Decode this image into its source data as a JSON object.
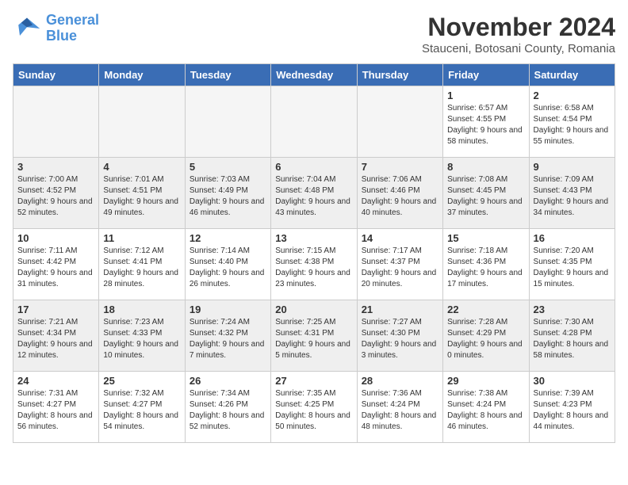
{
  "header": {
    "logo_line1": "General",
    "logo_line2": "Blue",
    "title": "November 2024",
    "subtitle": "Stauceni, Botosani County, Romania"
  },
  "columns": [
    "Sunday",
    "Monday",
    "Tuesday",
    "Wednesday",
    "Thursday",
    "Friday",
    "Saturday"
  ],
  "weeks": [
    {
      "shaded": false,
      "days": [
        {
          "num": "",
          "info": "",
          "empty": true
        },
        {
          "num": "",
          "info": "",
          "empty": true
        },
        {
          "num": "",
          "info": "",
          "empty": true
        },
        {
          "num": "",
          "info": "",
          "empty": true
        },
        {
          "num": "",
          "info": "",
          "empty": true
        },
        {
          "num": "1",
          "info": "Sunrise: 6:57 AM\nSunset: 4:55 PM\nDaylight: 9 hours and 58 minutes."
        },
        {
          "num": "2",
          "info": "Sunrise: 6:58 AM\nSunset: 4:54 PM\nDaylight: 9 hours and 55 minutes."
        }
      ]
    },
    {
      "shaded": true,
      "days": [
        {
          "num": "3",
          "info": "Sunrise: 7:00 AM\nSunset: 4:52 PM\nDaylight: 9 hours and 52 minutes."
        },
        {
          "num": "4",
          "info": "Sunrise: 7:01 AM\nSunset: 4:51 PM\nDaylight: 9 hours and 49 minutes."
        },
        {
          "num": "5",
          "info": "Sunrise: 7:03 AM\nSunset: 4:49 PM\nDaylight: 9 hours and 46 minutes."
        },
        {
          "num": "6",
          "info": "Sunrise: 7:04 AM\nSunset: 4:48 PM\nDaylight: 9 hours and 43 minutes."
        },
        {
          "num": "7",
          "info": "Sunrise: 7:06 AM\nSunset: 4:46 PM\nDaylight: 9 hours and 40 minutes."
        },
        {
          "num": "8",
          "info": "Sunrise: 7:08 AM\nSunset: 4:45 PM\nDaylight: 9 hours and 37 minutes."
        },
        {
          "num": "9",
          "info": "Sunrise: 7:09 AM\nSunset: 4:43 PM\nDaylight: 9 hours and 34 minutes."
        }
      ]
    },
    {
      "shaded": false,
      "days": [
        {
          "num": "10",
          "info": "Sunrise: 7:11 AM\nSunset: 4:42 PM\nDaylight: 9 hours and 31 minutes."
        },
        {
          "num": "11",
          "info": "Sunrise: 7:12 AM\nSunset: 4:41 PM\nDaylight: 9 hours and 28 minutes."
        },
        {
          "num": "12",
          "info": "Sunrise: 7:14 AM\nSunset: 4:40 PM\nDaylight: 9 hours and 26 minutes."
        },
        {
          "num": "13",
          "info": "Sunrise: 7:15 AM\nSunset: 4:38 PM\nDaylight: 9 hours and 23 minutes."
        },
        {
          "num": "14",
          "info": "Sunrise: 7:17 AM\nSunset: 4:37 PM\nDaylight: 9 hours and 20 minutes."
        },
        {
          "num": "15",
          "info": "Sunrise: 7:18 AM\nSunset: 4:36 PM\nDaylight: 9 hours and 17 minutes."
        },
        {
          "num": "16",
          "info": "Sunrise: 7:20 AM\nSunset: 4:35 PM\nDaylight: 9 hours and 15 minutes."
        }
      ]
    },
    {
      "shaded": true,
      "days": [
        {
          "num": "17",
          "info": "Sunrise: 7:21 AM\nSunset: 4:34 PM\nDaylight: 9 hours and 12 minutes."
        },
        {
          "num": "18",
          "info": "Sunrise: 7:23 AM\nSunset: 4:33 PM\nDaylight: 9 hours and 10 minutes."
        },
        {
          "num": "19",
          "info": "Sunrise: 7:24 AM\nSunset: 4:32 PM\nDaylight: 9 hours and 7 minutes."
        },
        {
          "num": "20",
          "info": "Sunrise: 7:25 AM\nSunset: 4:31 PM\nDaylight: 9 hours and 5 minutes."
        },
        {
          "num": "21",
          "info": "Sunrise: 7:27 AM\nSunset: 4:30 PM\nDaylight: 9 hours and 3 minutes."
        },
        {
          "num": "22",
          "info": "Sunrise: 7:28 AM\nSunset: 4:29 PM\nDaylight: 9 hours and 0 minutes."
        },
        {
          "num": "23",
          "info": "Sunrise: 7:30 AM\nSunset: 4:28 PM\nDaylight: 8 hours and 58 minutes."
        }
      ]
    },
    {
      "shaded": false,
      "days": [
        {
          "num": "24",
          "info": "Sunrise: 7:31 AM\nSunset: 4:27 PM\nDaylight: 8 hours and 56 minutes."
        },
        {
          "num": "25",
          "info": "Sunrise: 7:32 AM\nSunset: 4:27 PM\nDaylight: 8 hours and 54 minutes."
        },
        {
          "num": "26",
          "info": "Sunrise: 7:34 AM\nSunset: 4:26 PM\nDaylight: 8 hours and 52 minutes."
        },
        {
          "num": "27",
          "info": "Sunrise: 7:35 AM\nSunset: 4:25 PM\nDaylight: 8 hours and 50 minutes."
        },
        {
          "num": "28",
          "info": "Sunrise: 7:36 AM\nSunset: 4:24 PM\nDaylight: 8 hours and 48 minutes."
        },
        {
          "num": "29",
          "info": "Sunrise: 7:38 AM\nSunset: 4:24 PM\nDaylight: 8 hours and 46 minutes."
        },
        {
          "num": "30",
          "info": "Sunrise: 7:39 AM\nSunset: 4:23 PM\nDaylight: 8 hours and 44 minutes."
        }
      ]
    }
  ]
}
